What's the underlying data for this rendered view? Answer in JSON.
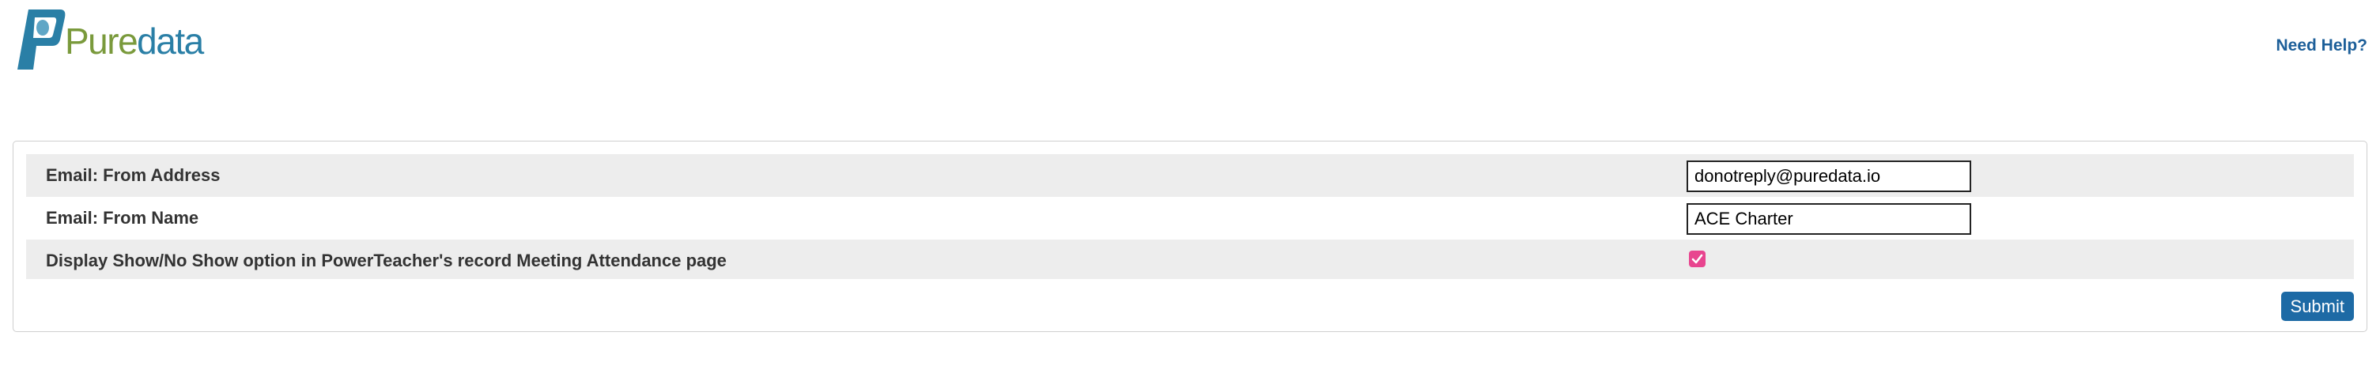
{
  "brand": {
    "logo_icon": "puredata-p-icon",
    "name_part1": "Pure",
    "name_part2": "data",
    "color_pure": "#7a9a3c",
    "color_data": "#2a7fa6"
  },
  "header": {
    "help_link": "Need Help?"
  },
  "settings": {
    "rows": [
      {
        "label": "Email: From Address",
        "value": "donotreply@puredata.io",
        "type": "text"
      },
      {
        "label": "Email: From Name",
        "value": "ACE Charter",
        "type": "text"
      },
      {
        "label": "Display Show/No Show option in PowerTeacher's record Meeting Attendance page",
        "checked": true,
        "type": "checkbox"
      }
    ],
    "submit_label": "Submit"
  },
  "colors": {
    "accent": "#1d6aa5",
    "link": "#1d5f99",
    "checkbox": "#e8458f",
    "row_shade": "#ededed"
  }
}
